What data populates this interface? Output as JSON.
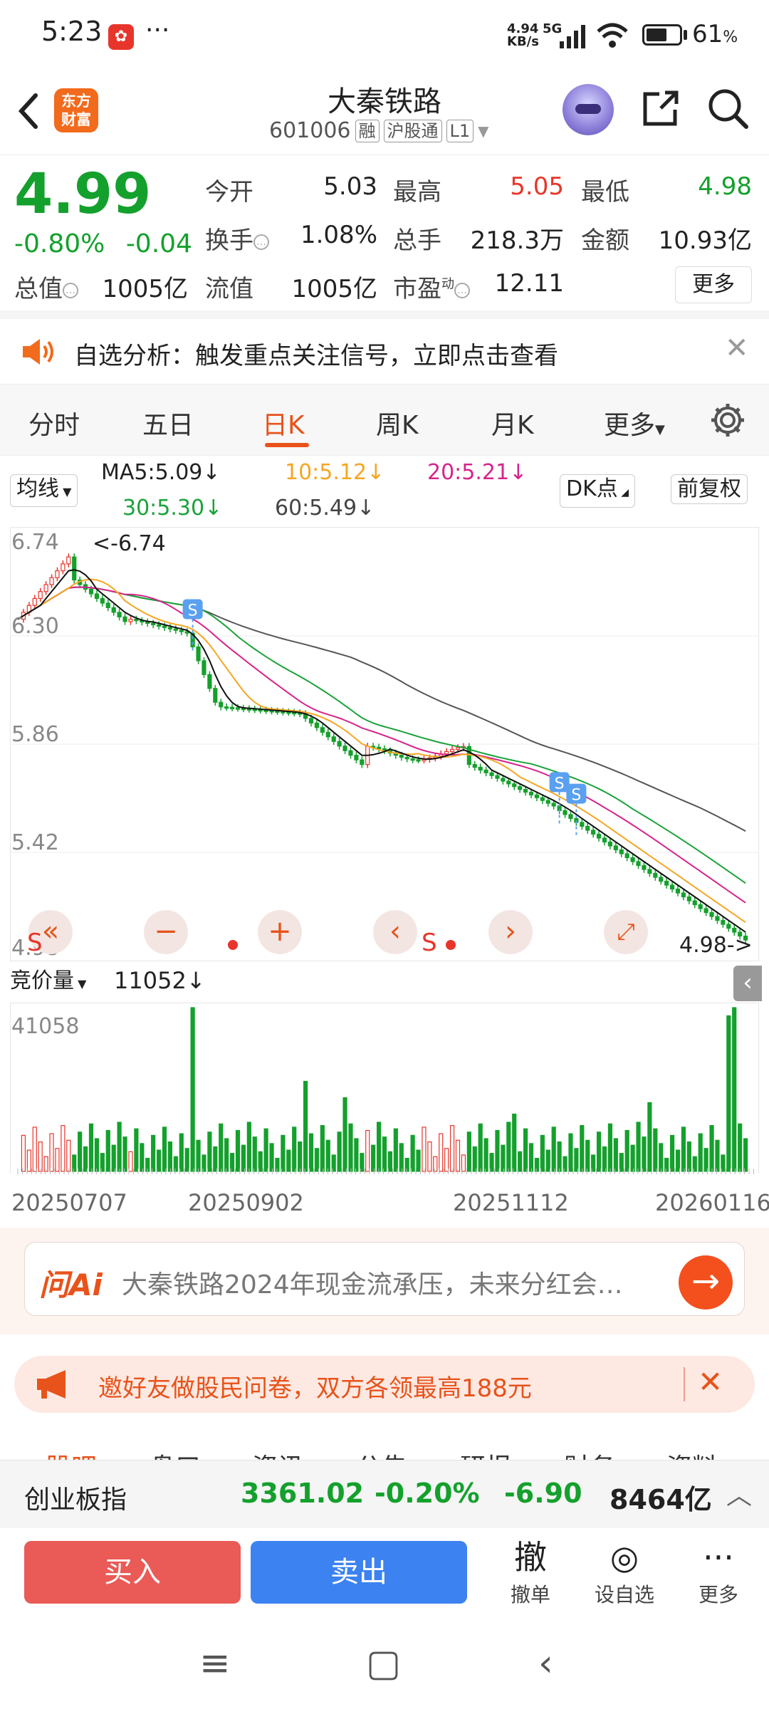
{
  "status_bar": {
    "time": "5:23",
    "net_speed": "4.94",
    "net_unit": "KB/s",
    "net_type": "5G",
    "battery": "61",
    "battery_pct_sign": "%"
  },
  "header": {
    "title": "大秦铁路",
    "code": "601006",
    "tags": [
      "融",
      "沪股通",
      "L1"
    ],
    "logo_text": "东方财富"
  },
  "quote": {
    "price": "4.99",
    "change_pct": "-0.80%",
    "change_amt": "-0.04",
    "fields": [
      {
        "label": "今开",
        "value": "5.03",
        "color": "#222222"
      },
      {
        "label": "最高",
        "value": "5.05",
        "color": "#e8352b"
      },
      {
        "label": "最低",
        "value": "4.98",
        "color": "#14a02c"
      },
      {
        "label": "换手",
        "value": "1.08%",
        "color": "#222222"
      },
      {
        "label": "总手",
        "value": "218.3万",
        "color": "#222222"
      },
      {
        "label": "金额",
        "value": "10.93亿",
        "color": "#222222"
      },
      {
        "label": "总值",
        "value": "1005亿",
        "color": "#222222"
      },
      {
        "label": "流值",
        "value": "1005亿",
        "color": "#222222"
      },
      {
        "label": "市盈",
        "value": "12.11",
        "color": "#222222"
      }
    ],
    "pe_superscript": "动",
    "more_label": "更多"
  },
  "notice": {
    "text": "自选分析：触发重点关注信号，立即点击查看"
  },
  "tabs": [
    "分时",
    "五日",
    "日K",
    "周K",
    "月K",
    "更多"
  ],
  "active_tab": "日K",
  "ma": {
    "selector": "均线",
    "ma5": "MA5:5.09↓",
    "ma10": "10:5.12↓",
    "ma20": "20:5.21↓",
    "ma30": "30:5.30↓",
    "ma60": "60:5.49↓",
    "dk_label": "DK点",
    "fq_label": "前复权"
  },
  "chart": {
    "y_labels": [
      "6.74",
      "6.30",
      "5.86",
      "5.42",
      "4.98"
    ],
    "high_label": "<-6.74",
    "low_label": "4.98->",
    "s_marker": "S",
    "colors": {
      "up": "#e8352b",
      "down": "#14a02c",
      "ma5": "#111111",
      "ma10": "#f5a623",
      "ma20": "#d6248c",
      "ma30": "#1aa33a",
      "ma60": "#555555"
    }
  },
  "volume": {
    "selector": "竞价量",
    "value": "11052↓",
    "y_label": "41058"
  },
  "x_dates": [
    "20250707",
    "20250902",
    "20251112",
    "20260116"
  ],
  "ai": {
    "brand": "问Ai",
    "question": "大秦铁路2024年现金流承压，未来分红会…"
  },
  "invite": {
    "text": "邀好友做股民问卷，双方各领最高188元"
  },
  "sub_tabs": [
    "股吧",
    "盘口",
    "资讯",
    "公告",
    "研报",
    "财务",
    "资料"
  ],
  "index_bar": {
    "name": "创业板指",
    "value": "3361.02",
    "pct": "-0.20%",
    "chg": "-6.90",
    "amount": "8464亿"
  },
  "trade": {
    "buy": "买入",
    "sell": "卖出",
    "tools": [
      {
        "icon": "撤",
        "label": "撤单"
      },
      {
        "icon": "◎",
        "label": "设自选"
      },
      {
        "icon": "···",
        "label": "更多"
      }
    ]
  }
}
